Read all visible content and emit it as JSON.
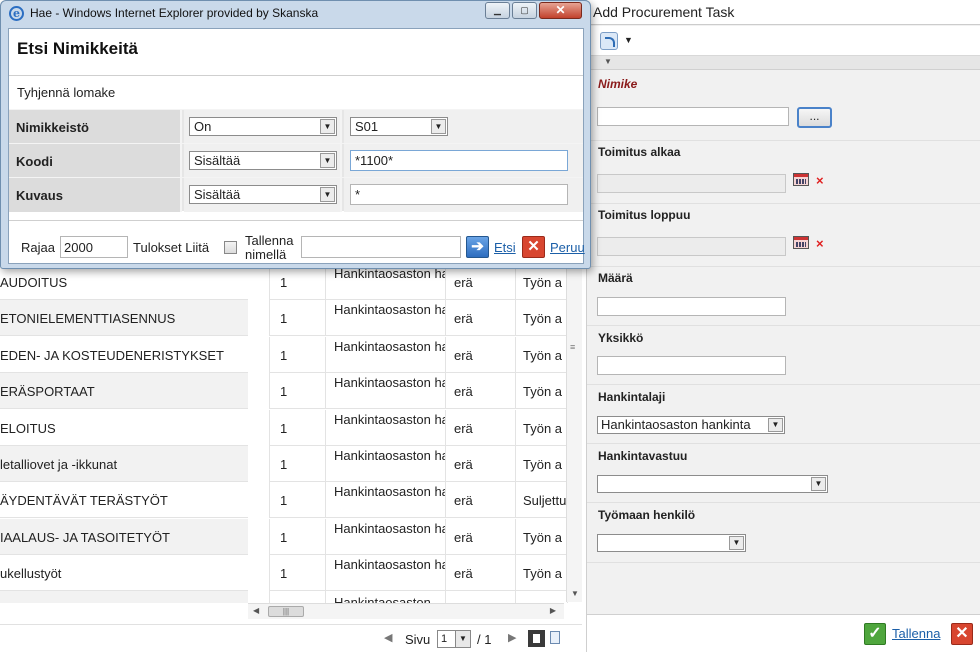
{
  "grid": {
    "rows": [
      {
        "name": "AUDOITUS",
        "qty": "1",
        "type": "Hankintaosaston hankinta",
        "unit": "erä",
        "status": "Työn a"
      },
      {
        "name": "ETONIELEMENTTIASENNUS",
        "qty": "1",
        "type": "Hankintaosaston hankinta",
        "unit": "erä",
        "status": "Työn a"
      },
      {
        "name": "EDEN- JA KOSTEUDENERISTYKSET",
        "qty": "1",
        "type": "Hankintaosaston hankinta",
        "unit": "erä",
        "status": "Työn a"
      },
      {
        "name": "ERÄSPORTAAT",
        "qty": "1",
        "type": "Hankintaosaston hankinta",
        "unit": "erä",
        "status": "Työn a"
      },
      {
        "name": "ELOITUS",
        "qty": "1",
        "type": "Hankintaosaston hankinta",
        "unit": "erä",
        "status": "Työn a"
      },
      {
        "name": "letalliovet ja -ikkunat",
        "qty": "1",
        "type": "Hankintaosaston hankinta",
        "unit": "erä",
        "status": "Työn a"
      },
      {
        "name": "ÄYDENTÄVÄT TERÄSTYÖT",
        "qty": "1",
        "type": "Hankintaosaston hankinta",
        "unit": "erä",
        "status": "Suljettu"
      },
      {
        "name": "IAALAUS- JA TASOITETYÖT",
        "qty": "1",
        "type": "Hankintaosaston hankinta",
        "unit": "erä",
        "status": "Työn a"
      },
      {
        "name": "ukellustyöt",
        "qty": "1",
        "type": "Hankintaosaston hankinta",
        "unit": "erä",
        "status": "Työn a"
      },
      {
        "name": "",
        "qty": "",
        "type": "Hankintaosaston",
        "unit": "",
        "status": ""
      }
    ]
  },
  "pager": {
    "page_label": "Sivu",
    "current_page": "1",
    "separator": "/",
    "total_pages": "1"
  },
  "right_panel": {
    "title": "Add Procurement Task",
    "fields": {
      "nimike_label": "Nimike",
      "browse_label": "...",
      "toimitus_alkaa_label": "Toimitus alkaa",
      "toimitus_loppuu_label": "Toimitus loppuu",
      "maara_label": "Määrä",
      "yksikko_label": "Yksikkö",
      "hankintalaji_label": "Hankintalaji",
      "hankintalaji_value": "Hankintaosaston hankinta",
      "hankintavastuu_label": "Hankintavastuu",
      "hankintavastuu_value": "",
      "tyomaan_henkilo_label": "Työmaan henkilö",
      "tyomaan_henkilo_value": ""
    },
    "footer": {
      "save_label": "Tallenna"
    }
  },
  "dialog": {
    "window_title": "Hae - Windows Internet Explorer provided by Skanska",
    "heading": "Etsi Nimikkeitä",
    "clear_form": "Tyhjennä lomake",
    "rows": [
      {
        "label": "Nimikkeistö",
        "operator": "On",
        "value": "S01"
      },
      {
        "label": "Koodi",
        "operator": "Sisältää",
        "value": "*1100*"
      },
      {
        "label": "Kuvaus",
        "operator": "Sisältää",
        "value": "*"
      }
    ],
    "limit_label": "Rajaa",
    "limit_value": "2000",
    "results_label": "Tulokset Liitä",
    "save_as_label": "Tallenna nimellä",
    "save_as_value": "",
    "search_label": "Etsi",
    "cancel_label": "Peruu"
  },
  "colors": {
    "link": "#1b5fa8",
    "required_label": "#8a1a1a",
    "accent": "#2d6dbf"
  }
}
